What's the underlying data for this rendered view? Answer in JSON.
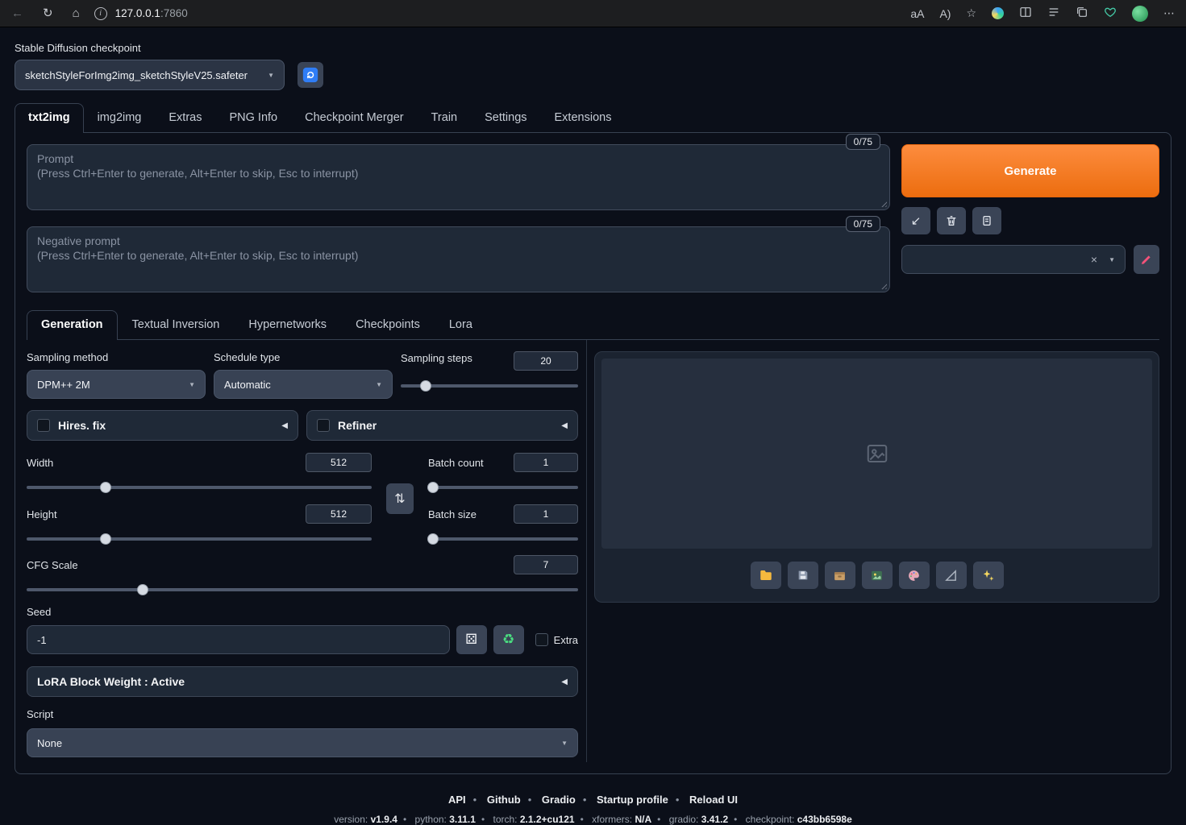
{
  "browser": {
    "url_host": "127.0.0.1",
    "url_port": ":7860",
    "icons": {
      "back": "←",
      "refresh": "↻",
      "home": "⌂",
      "info": "i",
      "translate": "aA",
      "read_aloud": "A)",
      "star": "☆",
      "menu": "⋯"
    }
  },
  "checkpoint": {
    "label": "Stable Diffusion checkpoint",
    "value": "sketchStyleForImg2img_sketchStyleV25.safeter"
  },
  "main_tabs": [
    "txt2img",
    "img2img",
    "Extras",
    "PNG Info",
    "Checkpoint Merger",
    "Train",
    "Settings",
    "Extensions"
  ],
  "prompt": {
    "counter": "0/75",
    "title": "Prompt",
    "hint": "(Press Ctrl+Enter to generate, Alt+Enter to skip, Esc to interrupt)"
  },
  "negative_prompt": {
    "counter": "0/75",
    "title": "Negative prompt",
    "hint": "(Press Ctrl+Enter to generate, Alt+Enter to skip, Esc to interrupt)"
  },
  "actions": {
    "generate": "Generate"
  },
  "sub_tabs": [
    "Generation",
    "Textual Inversion",
    "Hypernetworks",
    "Checkpoints",
    "Lora"
  ],
  "generation": {
    "sampling_method_label": "Sampling method",
    "sampling_method_value": "DPM++ 2M",
    "schedule_type_label": "Schedule type",
    "schedule_type_value": "Automatic",
    "sampling_steps_label": "Sampling steps",
    "sampling_steps_value": "20",
    "hires_fix": "Hires. fix",
    "refiner": "Refiner",
    "width_label": "Width",
    "width_value": "512",
    "height_label": "Height",
    "height_value": "512",
    "batch_count_label": "Batch count",
    "batch_count_value": "1",
    "batch_size_label": "Batch size",
    "batch_size_value": "1",
    "cfg_label": "CFG Scale",
    "cfg_value": "7",
    "seed_label": "Seed",
    "seed_value": "-1",
    "extra_label": "Extra",
    "lora_accordion": "LoRA Block Weight : Active",
    "script_label": "Script",
    "script_value": "None"
  },
  "icons": {
    "caret": "▼",
    "accordion_arrow": "◀",
    "swap": "⇅",
    "dice": "⚄",
    "recycle": "♻",
    "clear": "×",
    "paste": "↙"
  },
  "footer": {
    "links": [
      "API",
      "Github",
      "Gradio",
      "Startup profile",
      "Reload UI"
    ],
    "separator": "•",
    "version": [
      {
        "label": "version:",
        "value": "v1.9.4"
      },
      {
        "label": "python:",
        "value": "3.11.1"
      },
      {
        "label": "torch:",
        "value": "2.1.2+cu121"
      },
      {
        "label": "xformers:",
        "value": "N/A"
      },
      {
        "label": "gradio:",
        "value": "3.41.2"
      },
      {
        "label": "checkpoint:",
        "value": "c43bb6598e"
      }
    ]
  },
  "colors": {
    "page_bg": "#0b0f19",
    "panel": "#1f2937",
    "border": "#374151",
    "accent_orange": "#ec6d0f"
  }
}
